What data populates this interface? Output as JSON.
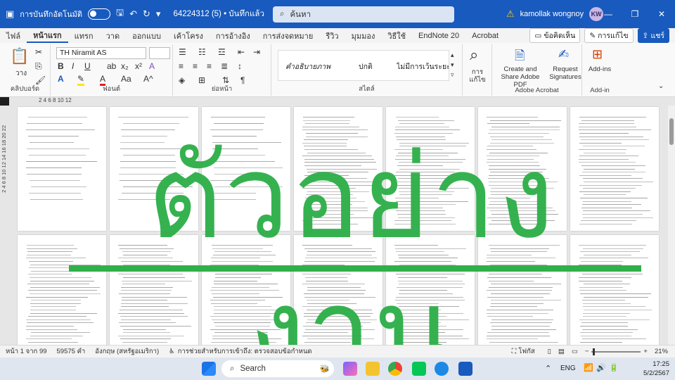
{
  "titlebar": {
    "autosave_label": "การบันทึกอัตโนมัติ",
    "doc_title": "64224312 (5) • บันทึกแล้ว",
    "search_placeholder": "ค้นหา",
    "user_name": "kamollak wongnoy",
    "user_initials": "KW"
  },
  "tabs": [
    "ไฟล์",
    "หน้าแรก",
    "แทรก",
    "วาด",
    "ออกแบบ",
    "เค้าโครง",
    "การอ้างอิง",
    "การส่งจดหมาย",
    "รีวิว",
    "มุมมอง",
    "วิธีใช้",
    "EndNote 20",
    "Acrobat"
  ],
  "tab_actions": {
    "comments": "ข้อคิดเห็น",
    "editing": "การแก้ไข",
    "share": "แชร์"
  },
  "ribbon": {
    "clipboard_paste": "วาง",
    "clipboard_label": "คลิปบอร์ด",
    "font_name": "TH Niramit AS",
    "font_size": "",
    "font_label": "ฟอนต์",
    "paragraph_label": "ย่อหน้า",
    "styles": [
      "คำอธิบายภาพ",
      "ปกติ",
      "ไม่มีการเว้นระยะห่"
    ],
    "styles_label": "สไตล์",
    "find_label": "การ แก้ไข",
    "acrobat_create": "Create and Share Adobe PDF",
    "acrobat_request": "Request Signatures",
    "acrobat_label": "Adobe Acrobat",
    "addins_label": "Add-ins",
    "addins_group": "Add-in"
  },
  "ruler_top": "2  4  6  8  10  12",
  "ruler_left": "2  4  6  8  10  12  14  16  18  20  22",
  "watermark": "ตัวอย่างงาน",
  "status": {
    "page": "หน้า 1 จาก 99",
    "words": "59575 คำ",
    "language": "อังกฤษ (สหรัฐอเมริกา)",
    "accessibility": "การช่วยสำหรับการเข้าถึง: ตรวจสอบข้อกำหนด",
    "focus": "โฟกัส",
    "zoom": "21%"
  },
  "taskbar": {
    "search": "Search",
    "lang": "ENG",
    "time": "17:25",
    "date": "5/2/2567"
  },
  "colors": {
    "accent": "#185abd",
    "watermark": "#2fb04a"
  }
}
